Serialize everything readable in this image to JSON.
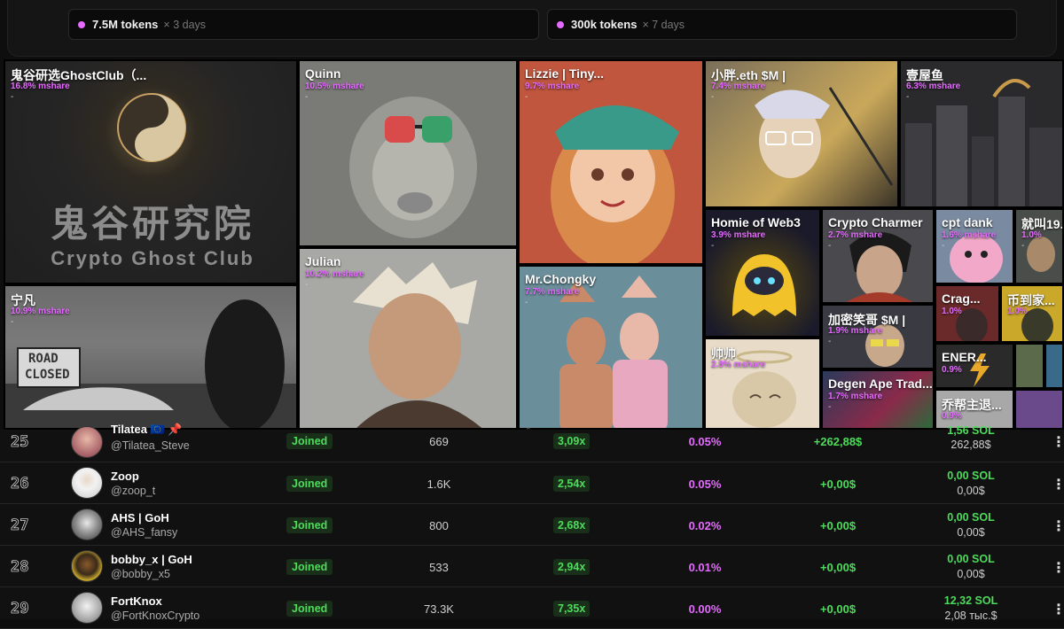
{
  "tokens": [
    {
      "amount": "7.5M tokens",
      "period": "× 3 days"
    },
    {
      "amount": "300k tokens",
      "period": "× 7 days"
    }
  ],
  "tiles": [
    {
      "name": "鬼谷研选GhostClub（...",
      "share": "16.8% mshare",
      "dash": "-",
      "overlay_line1": "鬼谷研究院",
      "overlay_line2": "Crypto Ghost Club"
    },
    {
      "name": "Quinn",
      "share": "10.5% mshare",
      "dash": "-"
    },
    {
      "name": "Lizzie | Tiny...",
      "share": "9.7% mshare",
      "dash": "-"
    },
    {
      "name": "小胖.eth $M |",
      "share": "7.4% mshare",
      "dash": "-"
    },
    {
      "name": "壹屋鱼",
      "share": "6.3% mshare",
      "dash": "-"
    },
    {
      "name": "宁凡",
      "share": "10.9% mshare",
      "dash": "-",
      "sign_line1": "ROAD",
      "sign_line2": "CLOSED"
    },
    {
      "name": "Julian",
      "share": "10.2% mshare",
      "dash": "-"
    },
    {
      "name": "Mr.Chongky",
      "share": "7.7% mshare",
      "dash": "-"
    },
    {
      "name": "Homie of Web3",
      "share": "3.9% mshare",
      "dash": "-"
    },
    {
      "name": "Crypto Charmer",
      "share": "2.7% mshare",
      "dash": "-"
    },
    {
      "name": "cpt dank",
      "share": "1.6% mshare",
      "dash": "-"
    },
    {
      "name": "就叫19...",
      "share": "1.0%",
      "dash": "-"
    },
    {
      "name": "Crag...",
      "share": "1.0%",
      "dash": ""
    },
    {
      "name": "币到家...",
      "share": "1.0%",
      "dash": ""
    },
    {
      "name": "加密笑哥 $M |",
      "share": "1.9% mshare",
      "dash": "-"
    },
    {
      "name": "帅帅",
      "share": "2.8% mshare",
      "dash": "-"
    },
    {
      "name": "ENER...",
      "share": "0.9%",
      "dash": ""
    },
    {
      "name": "Degen Ape Trad...",
      "share": "1.7% mshare",
      "dash": "-"
    },
    {
      "name": "乔帮主退...",
      "share": "0.9%",
      "dash": ""
    }
  ],
  "rows": [
    {
      "rank": "25",
      "name": "Tilatea 🇪🇺 📌",
      "handle": "@Tilatea_Steve",
      "status": "Joined",
      "followers": "669",
      "multiplier": "3,09x",
      "mshare": "0.05%",
      "profit": "+262,88$",
      "sol": "1,56 SOL",
      "usd": "262,88$"
    },
    {
      "rank": "26",
      "name": "Zoop",
      "handle": "@zoop_t",
      "status": "Joined",
      "followers": "1.6K",
      "multiplier": "2,54x",
      "mshare": "0.05%",
      "profit": "+0,00$",
      "sol": "0,00 SOL",
      "usd": "0,00$"
    },
    {
      "rank": "27",
      "name": "AHS | GoH",
      "handle": "@AHS_fansy",
      "status": "Joined",
      "followers": "800",
      "multiplier": "2,68x",
      "mshare": "0.02%",
      "profit": "+0,00$",
      "sol": "0,00 SOL",
      "usd": "0,00$"
    },
    {
      "rank": "28",
      "name": "bobby_x | GoH",
      "handle": "@bobby_x5",
      "status": "Joined",
      "followers": "533",
      "multiplier": "2,94x",
      "mshare": "0.01%",
      "profit": "+0,00$",
      "sol": "0,00 SOL",
      "usd": "0,00$"
    },
    {
      "rank": "29",
      "name": "FortKnox",
      "handle": "@FortKnoxCrypto",
      "status": "Joined",
      "followers": "73.3K",
      "multiplier": "7,35x",
      "mshare": "0.00%",
      "profit": "+0,00$",
      "sol": "12,32 SOL",
      "usd": "2,08 тыс.$"
    }
  ],
  "menu_glyph": "⋮",
  "colors": {
    "accent": "#e56bff",
    "positive": "#4cdc5a",
    "background": "#0e0e0e"
  }
}
